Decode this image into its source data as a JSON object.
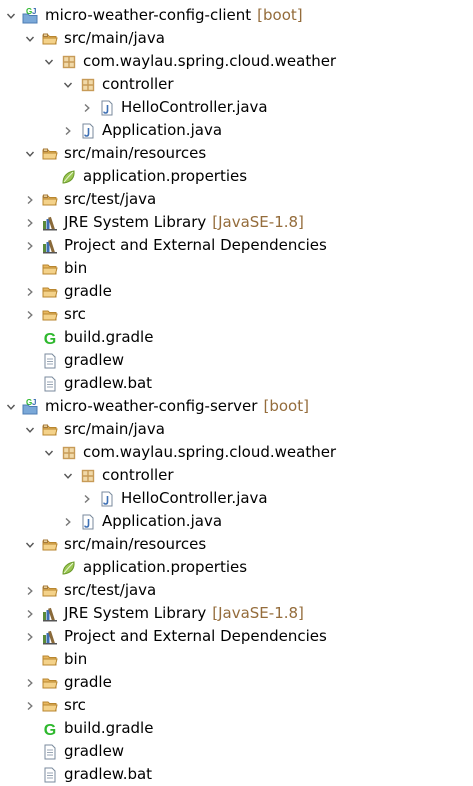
{
  "tree": [
    {
      "depth": 0,
      "toggle": "expanded",
      "icon": "gradle-project-icon",
      "label": "micro-weather-config-client",
      "decoration": "[boot]"
    },
    {
      "depth": 1,
      "toggle": "expanded",
      "icon": "source-folder-icon",
      "label": "src/main/java"
    },
    {
      "depth": 2,
      "toggle": "expanded",
      "icon": "package-icon",
      "label": "com.waylau.spring.cloud.weather"
    },
    {
      "depth": 3,
      "toggle": "expanded",
      "icon": "package-icon",
      "label": "controller"
    },
    {
      "depth": 4,
      "toggle": "collapsed",
      "icon": "java-file-icon",
      "label": "HelloController.java"
    },
    {
      "depth": 3,
      "toggle": "collapsed",
      "icon": "java-file-icon",
      "label": "Application.java"
    },
    {
      "depth": 1,
      "toggle": "expanded",
      "icon": "source-folder-icon",
      "label": "src/main/resources"
    },
    {
      "depth": 2,
      "toggle": "none",
      "icon": "properties-file-icon",
      "label": "application.properties"
    },
    {
      "depth": 1,
      "toggle": "collapsed",
      "icon": "source-folder-icon",
      "label": "src/test/java"
    },
    {
      "depth": 1,
      "toggle": "collapsed",
      "icon": "library-icon",
      "label": "JRE System Library",
      "decoration": "[JavaSE-1.8]"
    },
    {
      "depth": 1,
      "toggle": "collapsed",
      "icon": "library-icon",
      "label": "Project and External Dependencies"
    },
    {
      "depth": 1,
      "toggle": "none",
      "icon": "folder-icon",
      "label": "bin"
    },
    {
      "depth": 1,
      "toggle": "collapsed",
      "icon": "folder-icon",
      "label": "gradle"
    },
    {
      "depth": 1,
      "toggle": "collapsed",
      "icon": "folder-icon",
      "label": "src"
    },
    {
      "depth": 1,
      "toggle": "none",
      "icon": "gradle-file-icon",
      "label": "build.gradle"
    },
    {
      "depth": 1,
      "toggle": "none",
      "icon": "text-file-icon",
      "label": "gradlew"
    },
    {
      "depth": 1,
      "toggle": "none",
      "icon": "text-file-icon",
      "label": "gradlew.bat"
    },
    {
      "depth": 0,
      "toggle": "expanded",
      "icon": "gradle-project-icon",
      "label": "micro-weather-config-server",
      "decoration": "[boot]"
    },
    {
      "depth": 1,
      "toggle": "expanded",
      "icon": "source-folder-icon",
      "label": "src/main/java"
    },
    {
      "depth": 2,
      "toggle": "expanded",
      "icon": "package-icon",
      "label": "com.waylau.spring.cloud.weather"
    },
    {
      "depth": 3,
      "toggle": "expanded",
      "icon": "package-icon",
      "label": "controller"
    },
    {
      "depth": 4,
      "toggle": "collapsed",
      "icon": "java-file-icon",
      "label": "HelloController.java"
    },
    {
      "depth": 3,
      "toggle": "collapsed",
      "icon": "java-file-icon",
      "label": "Application.java"
    },
    {
      "depth": 1,
      "toggle": "expanded",
      "icon": "source-folder-icon",
      "label": "src/main/resources"
    },
    {
      "depth": 2,
      "toggle": "none",
      "icon": "properties-file-icon",
      "label": "application.properties"
    },
    {
      "depth": 1,
      "toggle": "collapsed",
      "icon": "source-folder-icon",
      "label": "src/test/java"
    },
    {
      "depth": 1,
      "toggle": "collapsed",
      "icon": "library-icon",
      "label": "JRE System Library",
      "decoration": "[JavaSE-1.8]"
    },
    {
      "depth": 1,
      "toggle": "collapsed",
      "icon": "library-icon",
      "label": "Project and External Dependencies"
    },
    {
      "depth": 1,
      "toggle": "none",
      "icon": "folder-icon",
      "label": "bin"
    },
    {
      "depth": 1,
      "toggle": "collapsed",
      "icon": "folder-icon",
      "label": "gradle"
    },
    {
      "depth": 1,
      "toggle": "collapsed",
      "icon": "folder-icon",
      "label": "src"
    },
    {
      "depth": 1,
      "toggle": "none",
      "icon": "gradle-file-icon",
      "label": "build.gradle"
    },
    {
      "depth": 1,
      "toggle": "none",
      "icon": "text-file-icon",
      "label": "gradlew"
    },
    {
      "depth": 1,
      "toggle": "none",
      "icon": "text-file-icon",
      "label": "gradlew.bat"
    }
  ],
  "colors": {
    "decoration": "#946c3b",
    "folder": "#e8b862",
    "package": "#c79b57",
    "gradle": "#2eb82e",
    "java": "#3d6fb4",
    "library": "#8a6a3a"
  }
}
